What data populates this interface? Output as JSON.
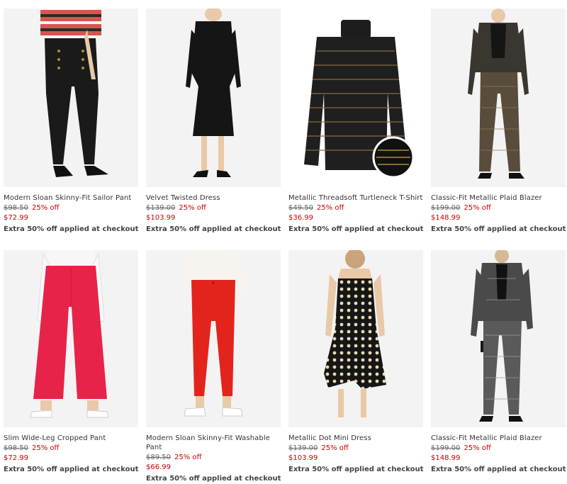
{
  "products": [
    {
      "name": "Modern Sloan Skinny-Fit Sailor Pant",
      "original_price": "$98.50",
      "discount": "25% off",
      "sale_price": "$72.99",
      "promo": "Extra 50% off applied at checkout"
    },
    {
      "name": "Velvet Twisted Dress",
      "original_price": "$139.00",
      "discount": "25% off",
      "sale_price": "$103.99",
      "promo": "Extra 50% off applied at checkout"
    },
    {
      "name": "Metallic Threadsoft Turtleneck T-Shirt",
      "original_price": "$49.50",
      "discount": "25% off",
      "sale_price": "$36.99",
      "promo": "Extra 50% off applied at checkout"
    },
    {
      "name": "Classic-Fit Metallic Plaid Blazer",
      "original_price": "$199.00",
      "discount": "25% off",
      "sale_price": "$148.99",
      "promo": "Extra 50% off applied at checkout"
    },
    {
      "name": "Slim Wide-Leg Cropped Pant",
      "original_price": "$98.50",
      "discount": "25% off",
      "sale_price": "$72.99",
      "promo": "Extra 50% off applied at checkout"
    },
    {
      "name": "Modern Sloan Skinny-Fit Washable Pant",
      "original_price": "$89.50",
      "discount": "25% off",
      "sale_price": "$66.99",
      "promo": "Extra 50% off applied at checkout"
    },
    {
      "name": "Metallic Dot Mini Dress",
      "original_price": "$139.00",
      "discount": "25% off",
      "sale_price": "$103.99",
      "promo": "Extra 50% off applied at checkout"
    },
    {
      "name": "Classic-Fit Metallic Plaid Blazer",
      "original_price": "$199.00",
      "discount": "25% off",
      "sale_price": "$148.99",
      "promo": "Extra 50% off applied at checkout"
    }
  ],
  "colors": {
    "sale_red": "#cc0000",
    "text": "#333333",
    "strike": "#666666"
  }
}
